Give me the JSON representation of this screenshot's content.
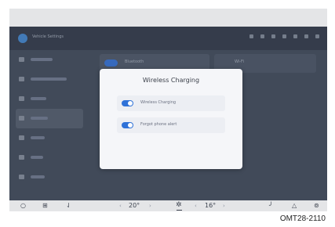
{
  "header": {
    "app_title": "Vehicle Settings",
    "status_icon_count": 7
  },
  "sidebar": {
    "items": [
      {
        "name": "nav-item-1",
        "bar": 28,
        "active": false
      },
      {
        "name": "nav-item-2",
        "bar": 46,
        "active": false
      },
      {
        "name": "nav-item-3",
        "bar": 20,
        "active": false
      },
      {
        "name": "nav-item-4",
        "bar": 22,
        "active": true
      },
      {
        "name": "nav-item-5",
        "bar": 18,
        "active": false
      },
      {
        "name": "nav-item-6",
        "bar": 16,
        "active": false
      },
      {
        "name": "nav-item-7",
        "bar": 18,
        "active": false
      }
    ]
  },
  "background_content": {
    "left_row_label": "Bluetooth",
    "right_card_label": "Wi-Fi"
  },
  "dialog": {
    "title": "Wireless Charging",
    "options": [
      {
        "label": "Wireless Charging",
        "enabled": true
      },
      {
        "label": "Forgot phone alert",
        "enabled": true
      }
    ]
  },
  "bottom_bar": {
    "driver_temp": "20°",
    "passenger_temp": "16°",
    "icons": [
      "home-icon",
      "grid-icon",
      "seat-heat-icon",
      "fan-icon",
      "wiper-icon",
      "mirror-icon",
      "settings-icon"
    ]
  },
  "caption": "OMT28-2110"
}
